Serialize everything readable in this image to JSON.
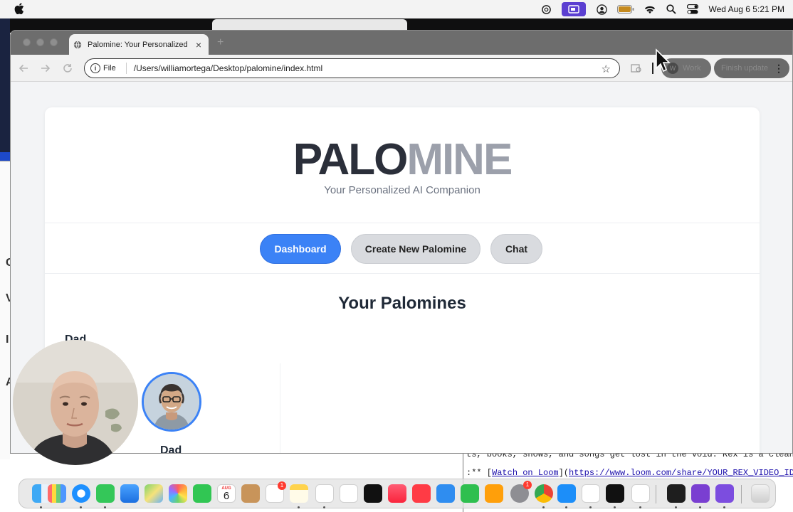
{
  "menubar": {
    "clock": "Wed Aug 6  5:21 PM"
  },
  "browser": {
    "tab_title": "Palomine: Your Personalized AI Companion",
    "address_scheme": "File",
    "address_url": "/Users/williamortega/Desktop/palomine/index.html",
    "profile_initial": "W",
    "profile_label": "Work",
    "update_label": "Finish update"
  },
  "app": {
    "logo_dark": "PALO",
    "logo_light": "MINE",
    "tagline": "Your Personalized AI Companion",
    "nav": [
      {
        "label": "Dashboard",
        "active": true
      },
      {
        "label": "Create New Palomine",
        "active": false
      },
      {
        "label": "Chat",
        "active": false
      }
    ],
    "section_title": "Your Palomines",
    "member_name_top": "Dad",
    "member_name_bottom": "Dad"
  },
  "terminal": {
    "line1": "ts, books, shows, and songs get lost in the void. Rex is a clean, i",
    "line2_prefix": ":** [",
    "line2_link": "Watch on Loom",
    "line2_mid": "](",
    "line2_url": "https://www.loom.com/share/YOUR_REX_VIDEO_ID",
    "line2_suffix": ")"
  },
  "desktop": {
    "left_letters": [
      "C",
      "V",
      "I",
      "A"
    ]
  },
  "dock": {
    "apps": [
      "finder-icon",
      "launchpad-icon",
      "safari-icon",
      "messages-icon",
      "mail-icon",
      "maps-icon",
      "photos-icon",
      "facetime-icon",
      "calendar-icon",
      "contacts-icon",
      "reminders-icon",
      "notes-icon",
      "chatgpt-icon",
      "freeform-icon",
      "tv-icon",
      "music-icon",
      "news-icon",
      "keynote-icon",
      "numbers-icon",
      "pages-icon",
      "settings-icon",
      "chrome-icon",
      "appstore-icon",
      "slack-icon",
      "cursor-app-icon",
      "vscode-icon",
      "terminal-icon",
      "github-desktop-icon",
      "perplexity-icon",
      "trash-icon"
    ],
    "calendar_month": "AUG",
    "calendar_day": "6",
    "badge_reminders": "1",
    "badge_settings": "1"
  },
  "colors": {
    "accent": "#3b82f6",
    "logo_dark": "#2b2f3a",
    "logo_light": "#9ca0ab"
  }
}
